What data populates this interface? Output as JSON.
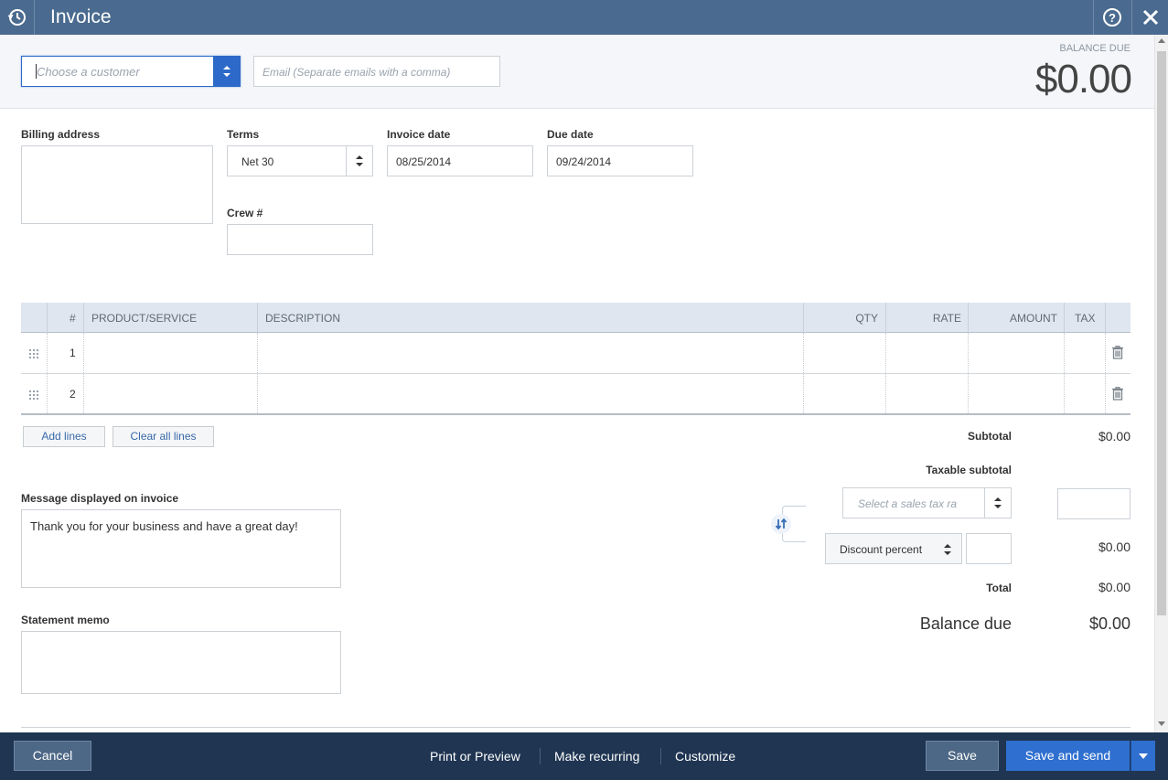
{
  "window": {
    "title": "Invoice"
  },
  "header": {
    "customer_placeholder": "Choose a customer",
    "email_placeholder": "Email (Separate emails with a comma)",
    "balance_due_label": "BALANCE DUE",
    "balance_due_amount": "$0.00"
  },
  "form": {
    "billing_address_label": "Billing address",
    "terms_label": "Terms",
    "terms_value": "Net 30",
    "invoice_date_label": "Invoice date",
    "invoice_date_value": "08/25/2014",
    "due_date_label": "Due date",
    "due_date_value": "09/24/2014",
    "crew_label": "Crew #"
  },
  "table": {
    "headers": {
      "num": "#",
      "product": "PRODUCT/SERVICE",
      "description": "DESCRIPTION",
      "qty": "QTY",
      "rate": "RATE",
      "amount": "AMOUNT",
      "tax": "TAX"
    },
    "rows": [
      {
        "num": "1"
      },
      {
        "num": "2"
      }
    ]
  },
  "table_actions": {
    "add_lines": "Add lines",
    "clear_all_lines": "Clear all lines"
  },
  "totals": {
    "subtotal_label": "Subtotal",
    "subtotal_value": "$0.00",
    "taxable_subtotal_label": "Taxable subtotal",
    "tax_rate_placeholder": "Select a sales tax ra",
    "discount_type": "Discount percent",
    "discount_value": "$0.00",
    "total_label": "Total",
    "total_value": "$0.00",
    "balance_due_label": "Balance due",
    "balance_due_value": "$0.00"
  },
  "message": {
    "label": "Message displayed on invoice",
    "value": "Thank you for your business and have a great day!"
  },
  "memo": {
    "label": "Statement memo"
  },
  "footer": {
    "cancel": "Cancel",
    "print_preview": "Print or Preview",
    "make_recurring": "Make recurring",
    "customize": "Customize",
    "save": "Save",
    "save_and_send": "Save and send"
  },
  "colors": {
    "titlebar": "#4a6b8f",
    "footer": "#1f3552",
    "primary_button": "#2f6fcf",
    "secondary_button": "#4d6886"
  }
}
